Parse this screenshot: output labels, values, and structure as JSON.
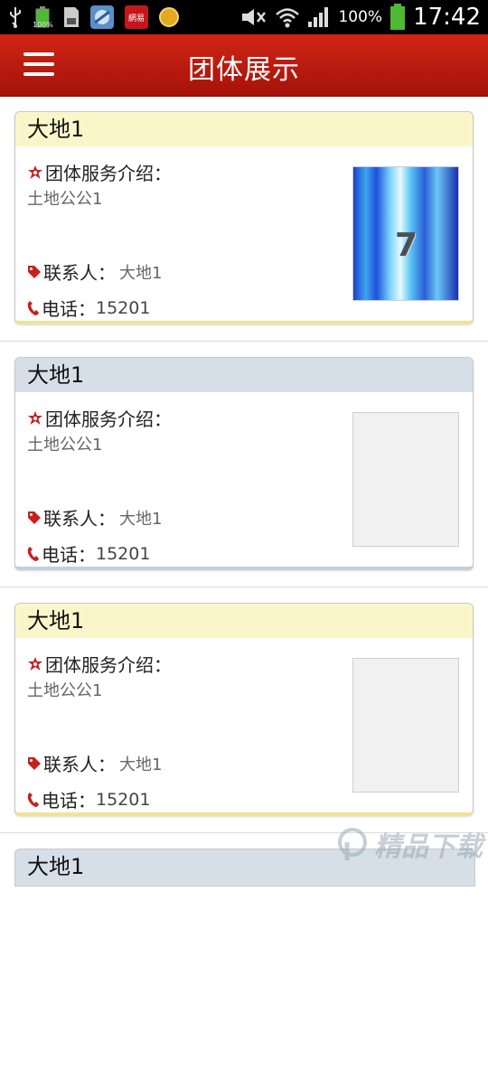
{
  "status_bar": {
    "battery_small_label": "100%",
    "battery_percent": "100%",
    "time": "17:42",
    "icons": [
      "usb-icon",
      "battery-small-icon",
      "sd-card-icon",
      "browser-app-icon",
      "netease-app-icon",
      "circle-app-icon",
      "mute-icon",
      "wifi-icon",
      "signal-icon",
      "battery-icon"
    ],
    "netease_label": "網易"
  },
  "app_bar": {
    "title": "团体展示",
    "menu_icon": "hamburger-menu-icon"
  },
  "labels": {
    "intro": "团体服务介绍：",
    "contact": "联系人：",
    "phone": "电话："
  },
  "cards": [
    {
      "title": "大地1",
      "intro_text": "土地公公1",
      "contact": "大地1",
      "phone": "15201",
      "style": "yellow",
      "has_image": true,
      "image_text": "7"
    },
    {
      "title": "大地1",
      "intro_text": "土地公公1",
      "contact": "大地1",
      "phone": "15201",
      "style": "blue",
      "has_image": false
    },
    {
      "title": "大地1",
      "intro_text": "土地公公1",
      "contact": "大地1",
      "phone": "15201",
      "style": "yellow",
      "has_image": false
    },
    {
      "title": "大地1",
      "style": "blue"
    }
  ],
  "watermark": {
    "text": "精品下载"
  },
  "colors": {
    "app_bar": "#c0190d",
    "star_icon": "#c8201c",
    "tag_icon": "#c8201c",
    "phone_icon": "#c8201c",
    "yellow_header": "#fbf6c9",
    "blue_header": "#d6dfe8"
  }
}
